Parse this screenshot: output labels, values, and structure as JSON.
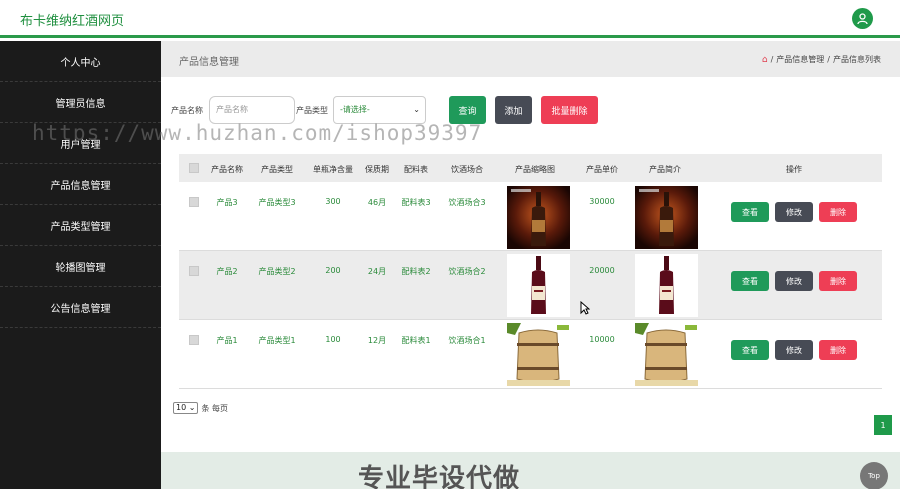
{
  "header": {
    "brand": "布卡维纳红酒网页"
  },
  "sidebar": {
    "items": [
      {
        "label": "个人中心"
      },
      {
        "label": "管理员信息"
      },
      {
        "label": "用户管理"
      },
      {
        "label": "产品信息管理"
      },
      {
        "label": "产品类型管理"
      },
      {
        "label": "轮播图管理"
      },
      {
        "label": "公告信息管理"
      }
    ]
  },
  "main": {
    "title": "产品信息管理",
    "breadcrumb": [
      "产品信息管理",
      "产品信息列表"
    ],
    "breadcrumb_sep": "/"
  },
  "search": {
    "name_label": "产品名称",
    "name_placeholder": "产品名称",
    "type_label": "产品类型",
    "type_selected": "-请选择-",
    "query_label": "查询",
    "add_label": "添加",
    "batch_delete_label": "批量删除"
  },
  "table": {
    "headers": [
      "产品名称",
      "产品类型",
      "单瓶净含量",
      "保质期",
      "配料表",
      "饮酒场合",
      "产品缩略图",
      "产品单价",
      "产品简介",
      "操作"
    ],
    "rows": [
      {
        "name": "产品3",
        "type": "产品类型3",
        "volume": "300",
        "shelf": "46月",
        "ingredients": "配料表3",
        "occasion": "饮酒场合3",
        "price": "30000",
        "image": "bottle-dark"
      },
      {
        "name": "产品2",
        "type": "产品类型2",
        "volume": "200",
        "shelf": "24月",
        "ingredients": "配料表2",
        "occasion": "饮酒场合2",
        "price": "20000",
        "image": "bottle-red"
      },
      {
        "name": "产品1",
        "type": "产品类型1",
        "volume": "100",
        "shelf": "12月",
        "ingredients": "配料表1",
        "occasion": "饮酒场合1",
        "price": "10000",
        "image": "barrel"
      }
    ],
    "actions": {
      "view": "查看",
      "edit": "修改",
      "delete": "删除"
    }
  },
  "pagination": {
    "page_size": "10",
    "per_page_label": "条 每页",
    "current_page": "1"
  },
  "footer": {
    "overlay_text": "专业毕设代做",
    "top_label": "Top"
  },
  "watermark": "https://www.huzhan.com/ishop39397",
  "colors": {
    "brand": "#1f8f3f",
    "query": "#1f9a5a",
    "add": "#474b55",
    "delete": "#ee3e55",
    "sidebar": "#1b1b1b"
  }
}
